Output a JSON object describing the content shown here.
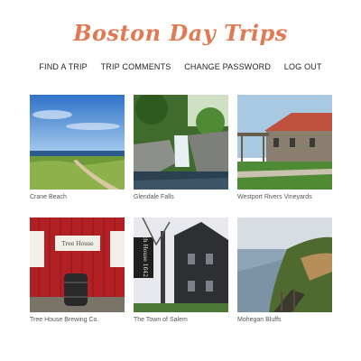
{
  "site": {
    "title": "Boston Day Trips"
  },
  "nav": {
    "items": [
      "FIND A TRIP",
      "TRIP COMMENTS",
      "CHANGE PASSWORD",
      "LOG OUT"
    ]
  },
  "trips": [
    {
      "name": "Crane Beach"
    },
    {
      "name": "Glendale Falls"
    },
    {
      "name": "Westport Rivers Vineyards"
    },
    {
      "name": "Tree House Brewing Co.",
      "sign": "Tree House"
    },
    {
      "name": "The Town of Salem",
      "sign": "Witch House 1642"
    },
    {
      "name": "Mohegan Bluffs"
    }
  ]
}
